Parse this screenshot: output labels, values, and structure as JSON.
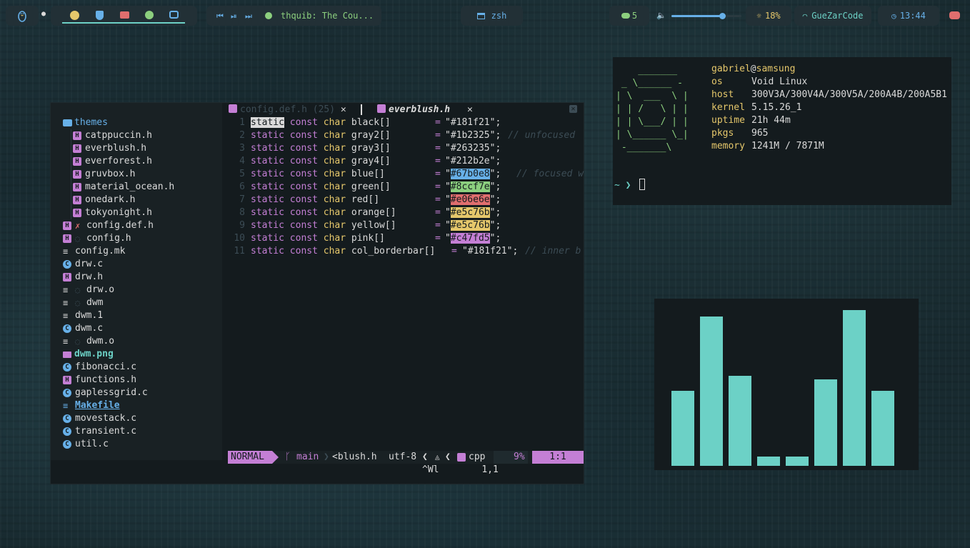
{
  "topbar": {
    "workspace_dot": "●",
    "apps": [
      "firefox",
      "bitwarden",
      "youtube",
      "spotify",
      "discord"
    ],
    "media": {
      "track": "thquib: The Cou..."
    },
    "terminal_title": "zsh",
    "updates": "5",
    "volume_fraction": 0.72,
    "brightness": "18%",
    "wifi": "GuеZarCode",
    "time": "13:44"
  },
  "tree": {
    "root": "themes",
    "themes": [
      "catppuccin.h",
      "everblush.h",
      "everforest.h",
      "gruvbox.h",
      "material_ocean.h",
      "onedark.h",
      "tokyonight.h"
    ],
    "files": [
      {
        "name": "config.def.h",
        "kind": "h",
        "mark": "✗"
      },
      {
        "name": "config.h",
        "kind": "h",
        "mark": "◌"
      },
      {
        "name": "config.mk",
        "kind": "txt"
      },
      {
        "name": "drw.c",
        "kind": "c"
      },
      {
        "name": "drw.h",
        "kind": "h"
      },
      {
        "name": "drw.o",
        "kind": "txt",
        "mark": "◌"
      },
      {
        "name": "dwm",
        "kind": "txt",
        "mark": "◌"
      },
      {
        "name": "dwm.1",
        "kind": "txt"
      },
      {
        "name": "dwm.c",
        "kind": "c"
      },
      {
        "name": "dwm.o",
        "kind": "txt",
        "mark": "◌"
      },
      {
        "name": "dwm.png",
        "kind": "img"
      },
      {
        "name": "fibonacci.c",
        "kind": "c"
      },
      {
        "name": "functions.h",
        "kind": "h"
      },
      {
        "name": "gaplessgrid.c",
        "kind": "c"
      },
      {
        "name": "Makefile",
        "kind": "make"
      },
      {
        "name": "movestack.c",
        "kind": "c"
      },
      {
        "name": "transient.c",
        "kind": "c"
      },
      {
        "name": "util.c",
        "kind": "c"
      }
    ]
  },
  "tabs": [
    {
      "label": "config.def.h",
      "count": "(25)",
      "close": "✕"
    },
    {
      "label": "everblush.h",
      "close": "✕"
    }
  ],
  "code": [
    {
      "n": "1",
      "name": "black[]",
      "val": "#181f21",
      "comment": ""
    },
    {
      "n": "2",
      "name": "gray2[]",
      "val": "#1b2325",
      "comment": "// unfocused"
    },
    {
      "n": "3",
      "name": "gray3[]",
      "val": "#263235",
      "comment": ""
    },
    {
      "n": "4",
      "name": "gray4[]",
      "val": "#212b2e",
      "comment": ""
    },
    {
      "n": "5",
      "name": "blue[]",
      "val": "#67b0e8",
      "comment": "// focused w",
      "hl": "#67b0e8"
    },
    {
      "n": "6",
      "name": "green[]",
      "val": "#8ccf7e",
      "comment": "",
      "hl": "#8ccf7e"
    },
    {
      "n": "7",
      "name": "red[]",
      "val": "#e06e6e",
      "comment": "",
      "hl": "#e06e6e"
    },
    {
      "n": "8",
      "name": "orange[]",
      "val": "#e5c76b",
      "comment": "",
      "hl": "#e5c76b"
    },
    {
      "n": "9",
      "name": "yellow[]",
      "val": "#e5c76b",
      "comment": "",
      "hl": "#e5c76b"
    },
    {
      "n": "10",
      "name": "pink[]",
      "val": "#c47fd5",
      "comment": "",
      "hl": "#c47fd5"
    },
    {
      "n": "11",
      "name": "col_borderbar[]",
      "val": "#181f21",
      "comment": "// inner b"
    }
  ],
  "keywords": {
    "static": "static",
    "const": "const",
    "char": "char"
  },
  "statusline": {
    "mode": "NORMAL",
    "branch": "main",
    "file": "<blush.h",
    "encoding": "utf-8",
    "filetype": "cpp",
    "percent": "9%",
    "position": "1:1"
  },
  "cmdline": {
    "keys": "^Wl",
    "pos": "1,1"
  },
  "fetch": {
    "user": "gabriel",
    "at": "@",
    "host": "samsung",
    "rows": [
      {
        "k": "os",
        "v": "Void Linux"
      },
      {
        "k": "host",
        "v": "300V3A/300V4A/300V5A/200A4B/200A5B1"
      },
      {
        "k": "kernel",
        "v": "5.15.26_1"
      },
      {
        "k": "uptime",
        "v": "21h 44m"
      },
      {
        "k": "pkgs",
        "v": "965"
      },
      {
        "k": "memory",
        "v": "1241M / 7871M"
      }
    ],
    "prompt": "~ ❯"
  },
  "cava": {
    "levels": [
      0.5,
      1.0,
      0.6,
      0.06,
      0.06,
      0.58,
      1.04,
      0.5
    ]
  },
  "colors": {
    "accent": "#c47fd5",
    "bar": "#6cd1c6",
    "green": "#8ccf7e",
    "blue": "#67b0e8"
  }
}
